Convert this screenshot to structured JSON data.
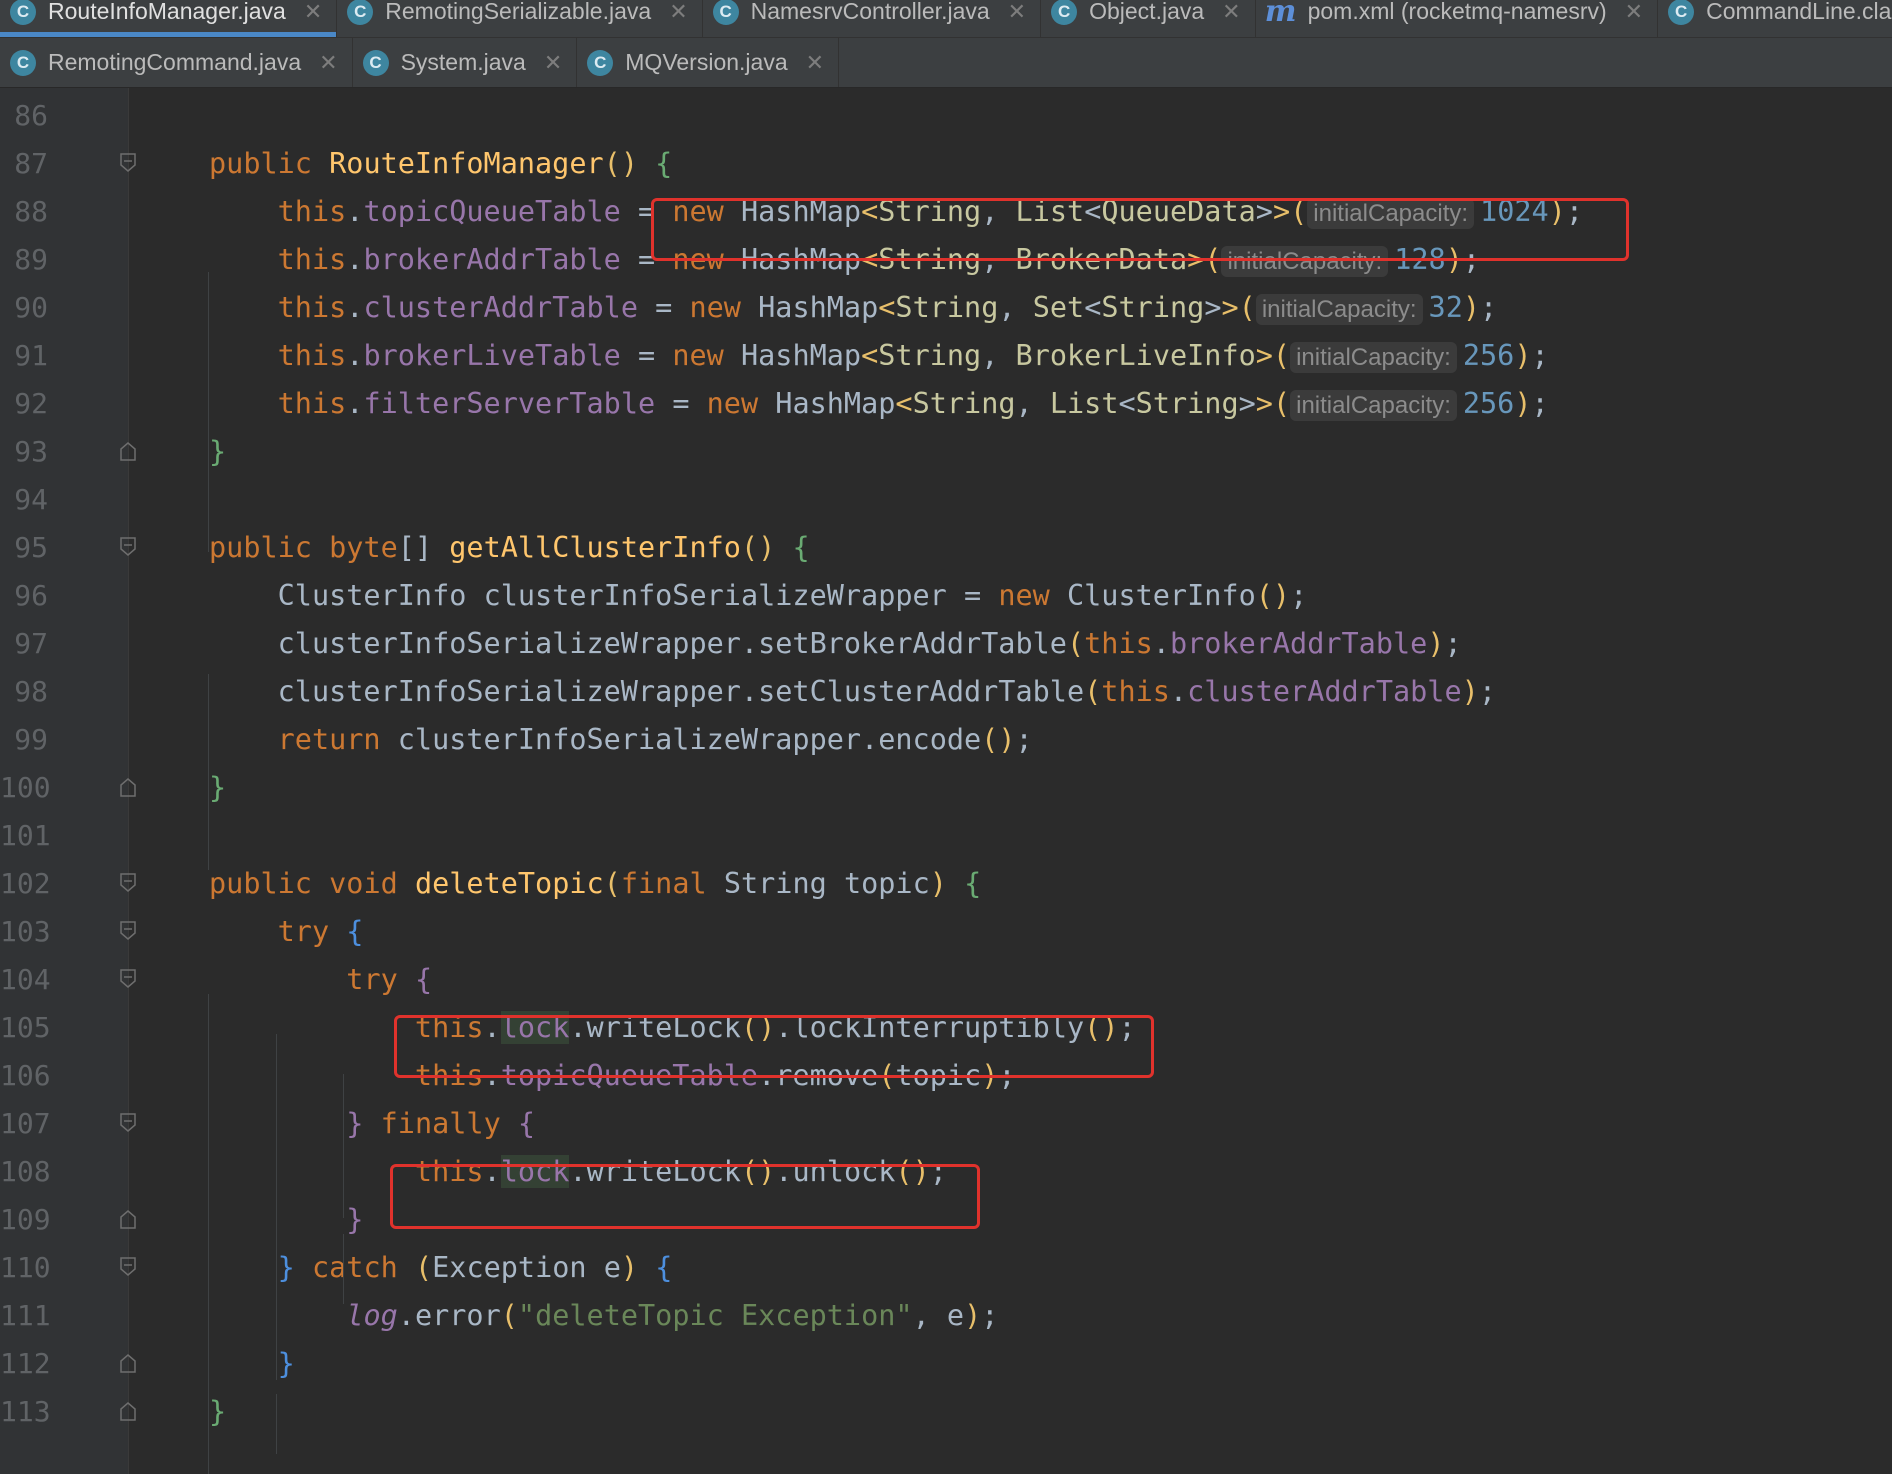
{
  "tabs_row1": [
    {
      "label": "RouteInfoManager.java",
      "icon": "class-icon",
      "active": true
    },
    {
      "label": "RemotingSerializable.java",
      "icon": "class-icon"
    },
    {
      "label": "NamesrvController.java",
      "icon": "class-icon"
    },
    {
      "label": "Object.java",
      "icon": "class-icon"
    },
    {
      "label": "pom.xml (rocketmq-namesrv)",
      "icon": "maven-icon"
    },
    {
      "label": "CommandLine.class",
      "icon": "class-icon"
    }
  ],
  "tabs_row2": [
    {
      "label": "RemotingCommand.java",
      "icon": "class-icon"
    },
    {
      "label": "System.java",
      "icon": "class-icon"
    },
    {
      "label": "MQVersion.java",
      "icon": "class-icon"
    }
  ],
  "lines": [
    {
      "n": "86"
    },
    {
      "n": "87"
    },
    {
      "n": "88"
    },
    {
      "n": "89"
    },
    {
      "n": "90"
    },
    {
      "n": "91"
    },
    {
      "n": "92"
    },
    {
      "n": "93"
    },
    {
      "n": "94"
    },
    {
      "n": "95"
    },
    {
      "n": "96"
    },
    {
      "n": "97"
    },
    {
      "n": "98"
    },
    {
      "n": "99"
    },
    {
      "n": "100"
    },
    {
      "n": "101"
    },
    {
      "n": "102"
    },
    {
      "n": "103"
    },
    {
      "n": "104"
    },
    {
      "n": "105"
    },
    {
      "n": "106"
    },
    {
      "n": "107"
    },
    {
      "n": "108"
    },
    {
      "n": "109"
    },
    {
      "n": "110"
    },
    {
      "n": "111"
    },
    {
      "n": "112"
    },
    {
      "n": "113"
    }
  ],
  "code": {
    "kw_public": "public",
    "kw_new": "new",
    "kw_this": "this",
    "kw_byte": "byte",
    "kw_void": "void",
    "kw_final": "final",
    "kw_return": "return",
    "kw_try": "try",
    "kw_finally": "finally",
    "kw_catch": "catch",
    "ctor_name": "RouteInfoManager",
    "m_getAll": "getAllClusterInfo",
    "m_delete": "deleteTopic",
    "f_topicQueueTable": "topicQueueTable",
    "f_brokerAddrTable": "brokerAddrTable",
    "f_clusterAddrTable": "clusterAddrTable",
    "f_brokerLiveTable": "brokerLiveTable",
    "f_filterServerTable": "filterServerTable",
    "f_lock": "lock",
    "f_log": "log",
    "t_HashMap": "HashMap",
    "t_String": "String",
    "t_List": "List",
    "t_Set": "Set",
    "t_QueueData": "QueueData",
    "t_BrokerData": "BrokerData",
    "t_BrokerLiveInfo": "BrokerLiveInfo",
    "t_ClusterInfo": "ClusterInfo",
    "t_Exception": "Exception",
    "v_wrapper": "clusterInfoSerializeWrapper",
    "v_topic": "topic",
    "v_e": "e",
    "hint_initialCapacity": "initialCapacity:",
    "n_1024": "1024",
    "n_128": "128",
    "n_32": "32",
    "n_256": "256",
    "m_setBrokerAddrTable": "setBrokerAddrTable",
    "m_setClusterAddrTable": "setClusterAddrTable",
    "m_encode": "encode",
    "m_writeLock": "writeLock",
    "m_lockInterruptibly": "lockInterruptibly",
    "m_remove": "remove",
    "m_unlock": "unlock",
    "m_error": "error",
    "s_deleteTopicException": "\"deleteTopic Exception\""
  },
  "colors": {
    "background": "#2b2b2b",
    "keyword": "#cc7832",
    "method": "#ffc66d",
    "field": "#9876aa",
    "number": "#6897bb",
    "string": "#6a8759",
    "highlight_box": "#e0322c"
  }
}
